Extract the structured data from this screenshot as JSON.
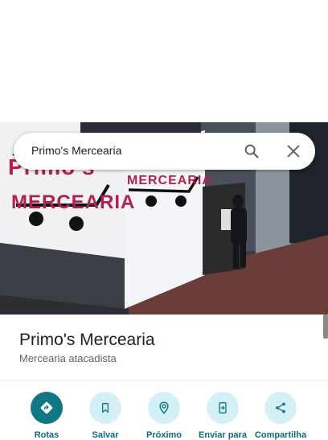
{
  "search": {
    "query": "Primo's Mercearia"
  },
  "photo": {
    "sign_left_line1": "Primo's",
    "sign_left_line2": "MERCEARIA",
    "sign_right_line1": "MERCEARIA"
  },
  "place": {
    "name": "Primo's Mercearia",
    "category": "Mercearia atacadista"
  },
  "actions": [
    {
      "label": "Rotas",
      "icon": "directions-icon"
    },
    {
      "label": "Salvar",
      "icon": "bookmark-icon"
    },
    {
      "label": "Próximo",
      "icon": "nearby-icon"
    },
    {
      "label": "Enviar para",
      "icon": "send-to-phone-icon"
    },
    {
      "label": "Compartilha",
      "icon": "share-icon"
    }
  ],
  "colors": {
    "accent": "#127785",
    "action_bg": "#d4f0f7",
    "sign_red": "#b0224a"
  }
}
